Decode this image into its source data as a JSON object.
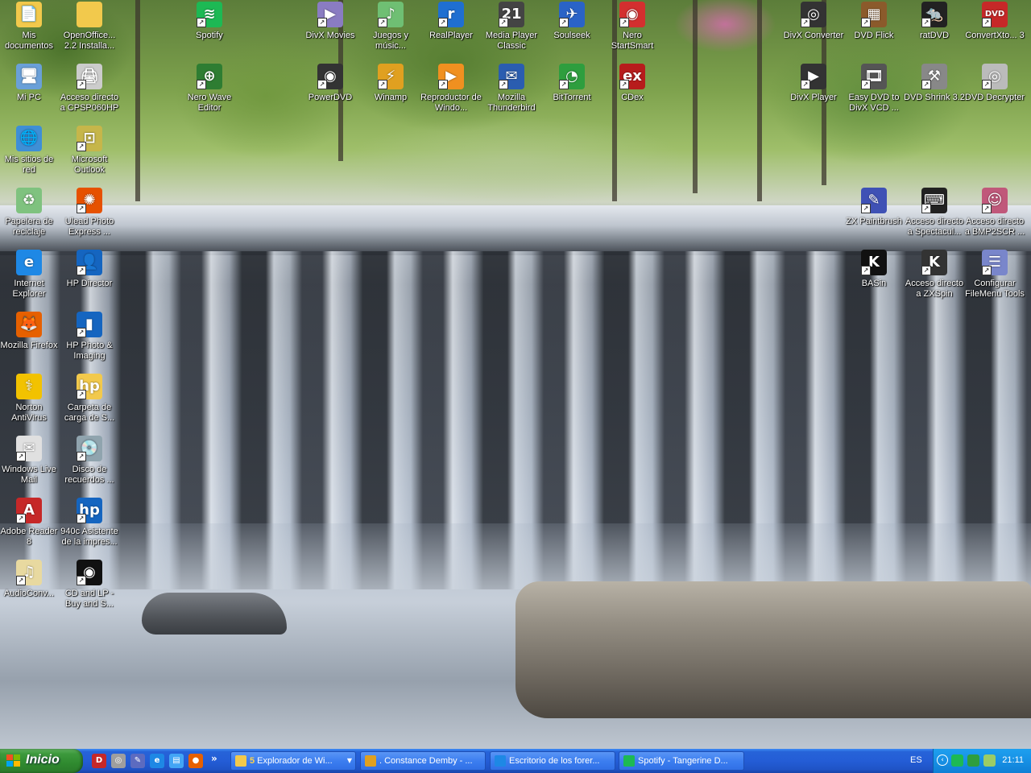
{
  "desktop": {
    "icons": [
      {
        "id": "mis-documentos",
        "label": "Mis documentos",
        "icon": "folder-documents-icon",
        "color": "#f2c94c",
        "glyph": "📄",
        "shortcut": false
      },
      {
        "id": "openoffice",
        "label": "OpenOffice... 2.2 Installa...",
        "icon": "folder-icon",
        "color": "#f2c94c",
        "glyph": "",
        "shortcut": false
      },
      {
        "id": "spotify",
        "label": "Spotify",
        "icon": "spotify-icon",
        "color": "#1db954",
        "glyph": "≋",
        "shortcut": true
      },
      {
        "id": "divx-movies",
        "label": "DivX Movies",
        "icon": "divx-movies-icon",
        "color": "#8a7cc2",
        "glyph": "▶",
        "shortcut": true
      },
      {
        "id": "juegos",
        "label": "Juegos y músic...",
        "icon": "games-icon",
        "color": "#6fbf73",
        "glyph": "♪",
        "shortcut": true
      },
      {
        "id": "realplayer",
        "label": "RealPlayer",
        "icon": "realplayer-icon",
        "color": "#1f6fd1",
        "glyph": "r",
        "shortcut": true
      },
      {
        "id": "mpc",
        "label": "Media Player Classic",
        "icon": "media-player-classic-icon",
        "color": "#444444",
        "glyph": "21",
        "shortcut": true
      },
      {
        "id": "soulseek",
        "label": "Soulseek",
        "icon": "soulseek-bird-icon",
        "color": "#2a63c7",
        "glyph": "✈",
        "shortcut": true
      },
      {
        "id": "nero",
        "label": "Nero StartSmart",
        "icon": "nero-icon",
        "color": "#d32f2f",
        "glyph": "◉",
        "shortcut": true
      },
      {
        "id": "divx-converter",
        "label": "DivX Converter",
        "icon": "divx-converter-icon",
        "color": "#333333",
        "glyph": "◎",
        "shortcut": true
      },
      {
        "id": "dvd-flick",
        "label": "DVD Flick",
        "icon": "dvd-flick-icon",
        "color": "#8b5a2b",
        "glyph": "▦",
        "shortcut": true
      },
      {
        "id": "ratdvd",
        "label": "ratDVD",
        "icon": "ratdvd-icon",
        "color": "#222222",
        "glyph": "🐀",
        "shortcut": true
      },
      {
        "id": "convertxto",
        "label": "ConvertXto... 3",
        "icon": "convertxtodvd-icon",
        "color": "#c62828",
        "glyph": "DVD",
        "shortcut": true
      },
      {
        "id": "mi-pc",
        "label": "Mi PC",
        "icon": "my-computer-icon",
        "color": "#6aa0d8",
        "glyph": "🖥",
        "shortcut": false
      },
      {
        "id": "cpsp",
        "label": "Acceso directo a CPSP060HP",
        "icon": "printer-icon",
        "color": "#cccccc",
        "glyph": "🖨",
        "shortcut": true
      },
      {
        "id": "nero-wave",
        "label": "Nero Wave Editor",
        "icon": "nero-wave-editor-icon",
        "color": "#2e7d32",
        "glyph": "⊕",
        "shortcut": true
      },
      {
        "id": "powerdvd",
        "label": "PowerDVD",
        "icon": "powerdvd-icon",
        "color": "#333333",
        "glyph": "◉",
        "shortcut": true
      },
      {
        "id": "winamp",
        "label": "Winamp",
        "icon": "winamp-icon",
        "color": "#e0a020",
        "glyph": "⚡",
        "shortcut": true
      },
      {
        "id": "wmp",
        "label": "Reproductor de Windo...",
        "icon": "windows-media-player-icon",
        "color": "#f09020",
        "glyph": "▶",
        "shortcut": true
      },
      {
        "id": "thunderbird",
        "label": "Mozilla Thunderbird",
        "icon": "thunderbird-icon",
        "color": "#2a5db0",
        "glyph": "✉",
        "shortcut": true
      },
      {
        "id": "bittorrent",
        "label": "BitTorrent",
        "icon": "bittorrent-icon",
        "color": "#2e9e3e",
        "glyph": "◔",
        "shortcut": true
      },
      {
        "id": "cdex",
        "label": "CDex",
        "icon": "cdex-icon",
        "color": "#b71c1c",
        "glyph": "ex",
        "shortcut": true
      },
      {
        "id": "divx-player",
        "label": "DivX Player",
        "icon": "divx-player-icon",
        "color": "#333333",
        "glyph": "▶",
        "shortcut": true
      },
      {
        "id": "easy-dvd",
        "label": "Easy DVD to DivX VCD ...",
        "icon": "film-reel-icon",
        "color": "#555555",
        "glyph": "🎞",
        "shortcut": true
      },
      {
        "id": "dvd-shrink",
        "label": "DVD Shrink 3.2",
        "icon": "dvd-shrink-icon",
        "color": "#888888",
        "glyph": "⚒",
        "shortcut": true
      },
      {
        "id": "dvd-decrypter",
        "label": "DVD Decrypter",
        "icon": "dvd-decrypter-icon",
        "color": "#bbbbbb",
        "glyph": "◎",
        "shortcut": true
      },
      {
        "id": "mis-sitios",
        "label": "Mis sitios de red",
        "icon": "network-places-icon",
        "color": "#3e8fd6",
        "glyph": "🌐",
        "shortcut": false
      },
      {
        "id": "outlook",
        "label": "Microsoft Outlook",
        "icon": "outlook-icon",
        "color": "#c6b64a",
        "glyph": "⊡",
        "shortcut": true
      },
      {
        "id": "papelera",
        "label": "Papelera de reciclaje",
        "icon": "recycle-bin-icon",
        "color": "#7fc27f",
        "glyph": "♻",
        "shortcut": false
      },
      {
        "id": "ulead",
        "label": "Ulead Photo Express ...",
        "icon": "ulead-photo-icon",
        "color": "#e65100",
        "glyph": "✺",
        "shortcut": true
      },
      {
        "id": "zx-paintbrush",
        "label": "ZX Paintbrush",
        "icon": "zx-paintbrush-icon",
        "color": "#3f51b5",
        "glyph": "✎",
        "shortcut": true
      },
      {
        "id": "spectaculator",
        "label": "Acceso directo a Spectacul...",
        "icon": "keyboard-icon",
        "color": "#222222",
        "glyph": "⌨",
        "shortcut": true
      },
      {
        "id": "bmp2scr",
        "label": "Acceso directo a BMP2SCR ...",
        "icon": "face-icon",
        "color": "#c0587a",
        "glyph": "☺",
        "shortcut": true
      },
      {
        "id": "ie",
        "label": "Internet Explorer",
        "icon": "internet-explorer-icon",
        "color": "#1e88e5",
        "glyph": "e",
        "shortcut": false
      },
      {
        "id": "hp-director",
        "label": "HP Director",
        "icon": "hp-director-icon",
        "color": "#1565c0",
        "glyph": "👤",
        "shortcut": true
      },
      {
        "id": "basin",
        "label": "BASin",
        "icon": "basin-icon",
        "color": "#111111",
        "glyph": "K",
        "shortcut": true
      },
      {
        "id": "zxspin",
        "label": "Acceso directo a ZXSpin",
        "icon": "zxspin-icon",
        "color": "#333333",
        "glyph": "K",
        "shortcut": true
      },
      {
        "id": "filemenu",
        "label": "Configurar FileMenu Tools",
        "icon": "filemenu-tools-icon",
        "color": "#7986cb",
        "glyph": "☰",
        "shortcut": true
      },
      {
        "id": "firefox",
        "label": "Mozilla Firefox",
        "icon": "firefox-icon",
        "color": "#e66000",
        "glyph": "🦊",
        "shortcut": false
      },
      {
        "id": "hp-photo",
        "label": "HP Photo & Imaging",
        "icon": "hp-photo-imaging-icon",
        "color": "#1565c0",
        "glyph": "▮",
        "shortcut": true
      },
      {
        "id": "norton",
        "label": "Norton AntiVirus",
        "icon": "norton-icon",
        "color": "#f2c200",
        "glyph": "⚕",
        "shortcut": false
      },
      {
        "id": "hp-carpeta",
        "label": "Carpeta de carga de S...",
        "icon": "hp-folder-icon",
        "color": "#f2c94c",
        "glyph": "hp",
        "shortcut": true
      },
      {
        "id": "wlm",
        "label": "Windows Live Mail",
        "icon": "windows-live-mail-icon",
        "color": "#e0e0e0",
        "glyph": "✉",
        "shortcut": true
      },
      {
        "id": "disco",
        "label": "Disco de recuerdos ...",
        "icon": "memories-disc-icon",
        "color": "#90a4ae",
        "glyph": "💿",
        "shortcut": true
      },
      {
        "id": "adobe",
        "label": "Adobe Reader 8",
        "icon": "adobe-reader-icon",
        "color": "#c62828",
        "glyph": "A",
        "shortcut": true
      },
      {
        "id": "hp-940c",
        "label": "940c Asistente de la impres...",
        "icon": "hp-logo-icon",
        "color": "#1565c0",
        "glyph": "hp",
        "shortcut": true
      },
      {
        "id": "audioconv",
        "label": "AudioConv...",
        "icon": "audio-converter-icon",
        "color": "#e8d9a0",
        "glyph": "♫",
        "shortcut": true
      },
      {
        "id": "cd-lp",
        "label": "CD and LP - Buy and S...",
        "icon": "vinyl-record-icon",
        "color": "#111111",
        "glyph": "◉",
        "shortcut": true
      }
    ]
  },
  "taskbar": {
    "start_label": "Inicio",
    "quick_launch": [
      {
        "id": "dvd",
        "icon": "dvd-quicklaunch-icon",
        "color": "#c62828",
        "glyph": "D"
      },
      {
        "id": "disc",
        "icon": "disc-quicklaunch-icon",
        "color": "#9e9e9e",
        "glyph": "◎"
      },
      {
        "id": "pen",
        "icon": "pen-quicklaunch-icon",
        "color": "#5c6bc0",
        "glyph": "✎"
      },
      {
        "id": "ie",
        "icon": "ie-quicklaunch-icon",
        "color": "#1e88e5",
        "glyph": "e"
      },
      {
        "id": "show",
        "icon": "show-desktop-quicklaunch-icon",
        "color": "#42a5f5",
        "glyph": "▤"
      },
      {
        "id": "ff",
        "icon": "firefox-quicklaunch-icon",
        "color": "#e66000",
        "glyph": "●"
      }
    ],
    "quick_more": "»",
    "buttons": [
      {
        "id": "explorer",
        "count": "5",
        "label": "Explorador de Wi...",
        "icon": "explorer-folder-icon",
        "color": "#f2c94c",
        "dropdown": "▼"
      },
      {
        "id": "winamp",
        "count": "",
        "label": ". Constance Demby - ...",
        "icon": "winamp-task-icon",
        "color": "#e0a020",
        "dropdown": ""
      },
      {
        "id": "forum",
        "count": "",
        "label": "Escritorio de los forer...",
        "icon": "ie-task-icon",
        "color": "#1e88e5",
        "dropdown": ""
      },
      {
        "id": "spotify",
        "count": "",
        "label": "Spotify - Tangerine D...",
        "icon": "spotify-task-icon",
        "color": "#1db954",
        "dropdown": ""
      }
    ],
    "language": "ES",
    "tray_icons": [
      {
        "id": "spotify",
        "icon": "spotify-tray-icon",
        "color": "#1db954"
      },
      {
        "id": "bittorrent",
        "icon": "bittorrent-tray-icon",
        "color": "#2e9e3e"
      },
      {
        "id": "network",
        "icon": "network-tray-icon",
        "color": "#9ccc65"
      }
    ],
    "tray_toggle": "‹",
    "clock": "21:11"
  }
}
